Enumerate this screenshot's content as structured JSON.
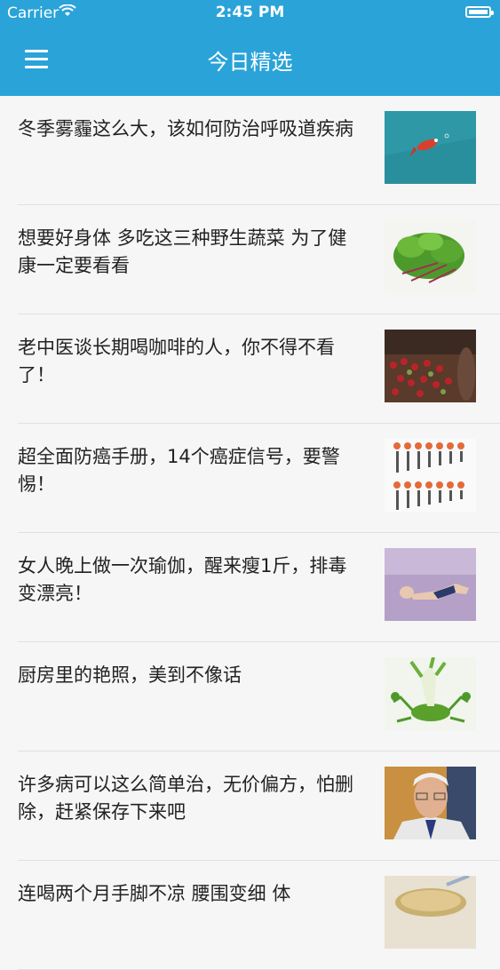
{
  "status_bar": {
    "carrier": "Carrier",
    "time": "2:45 PM"
  },
  "nav": {
    "title": "今日精选",
    "menu_icon": "menu-icon"
  },
  "articles": [
    {
      "title": "冬季雾霾这么大，该如何防治呼吸道疾病",
      "image": "fish-thumbnail"
    },
    {
      "title": "想要好身体 多吃这三种野生蔬菜 为了健康一定要看看",
      "image": "vegetable-thumbnail"
    },
    {
      "title": "老中医谈长期喝咖啡的人，你不得不看了！",
      "image": "coffee-beans-thumbnail"
    },
    {
      "title": "超全面防癌手册，14个癌症信号，要警惕！",
      "image": "cancer-chart-thumbnail"
    },
    {
      "title": "女人晚上做一次瑜伽，醒来瘦1斤，排毒变漂亮！",
      "image": "yoga-thumbnail"
    },
    {
      "title": "厨房里的艳照，美到不像话",
      "image": "vegetable-crab-thumbnail"
    },
    {
      "title": "许多病可以这么简单治，无价偏方，怕删除，赶紧保存下来吧",
      "image": "doctor-portrait-thumbnail"
    },
    {
      "title": "连喝两个月手脚不凉 腰围变细 体",
      "image": "soup-thumbnail"
    }
  ]
}
